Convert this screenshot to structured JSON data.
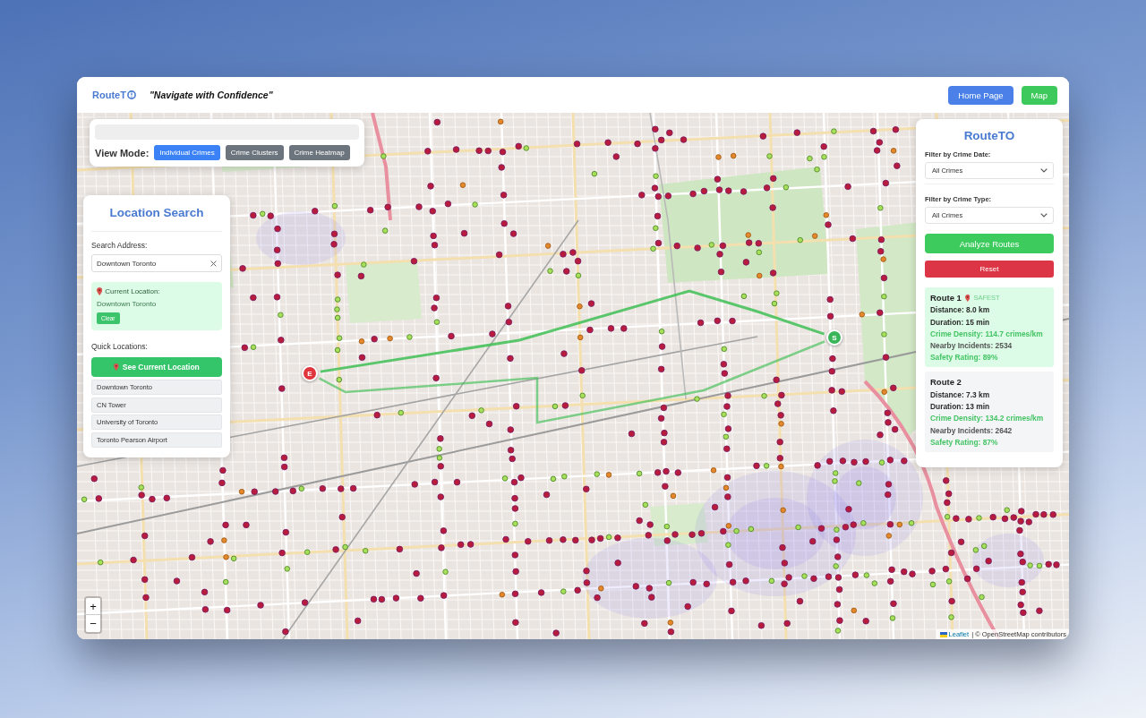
{
  "header": {
    "logo": "RouteT",
    "tagline": "\"Navigate with Confidence\"",
    "nav_buttons": [
      {
        "label": "Home Page",
        "kind": "primary"
      },
      {
        "label": "Map",
        "kind": "success"
      }
    ]
  },
  "view_mode": {
    "label": "View Mode:",
    "modes": [
      {
        "label": "Individual Crimes",
        "selected": true
      },
      {
        "label": "Crime Clusters",
        "selected": false
      },
      {
        "label": "Crime Heatmap",
        "selected": false
      }
    ]
  },
  "location_search": {
    "title": "Location Search",
    "search_label": "Search Address:",
    "search_value": "Downtown Toronto",
    "current_location": {
      "label": "Current Location:",
      "value": "Downtown Toronto",
      "clear_button": "Clear"
    },
    "quick_label": "Quick Locations:",
    "locate_button": "See Current Location",
    "quick_locations": [
      "Downtown Toronto",
      "CN Tower",
      "University of Toronto",
      "Toronto Pearson Airport"
    ]
  },
  "route_panel": {
    "title": "RouteTO",
    "filters": [
      {
        "label": "Filter by Crime Date:",
        "value": "All Crimes"
      },
      {
        "label": "Filter by Crime Type:",
        "value": "All Crimes"
      }
    ],
    "analyze_button": "Analyze Routes",
    "reset_button": "Reset",
    "routes": [
      {
        "name": "Route 1",
        "badge": "SAFEST",
        "selected": true,
        "lines": [
          {
            "text": "Distance: 8.0 km",
            "kind": "plain"
          },
          {
            "text": "Duration: 15 min",
            "kind": "plain"
          },
          {
            "text": "Crime Density: 114.7 crimes/km",
            "kind": "good"
          },
          {
            "text": "Nearby Incidents: 2534",
            "kind": "muted"
          },
          {
            "text": "Safety Rating: 89%",
            "kind": "good"
          }
        ]
      },
      {
        "name": "Route 2",
        "selected": false,
        "lines": [
          {
            "text": "Distance: 7.3 km",
            "kind": "plain"
          },
          {
            "text": "Duration: 13 min",
            "kind": "plain"
          },
          {
            "text": "Crime Density: 134.2 crimes/km",
            "kind": "good"
          },
          {
            "text": "Nearby Incidents: 2642",
            "kind": "muted"
          },
          {
            "text": "Safety Rating: 87%",
            "kind": "good"
          }
        ]
      }
    ]
  },
  "map": {
    "markers": [
      {
        "label": "S",
        "kind": "start"
      },
      {
        "label": "E",
        "kind": "end"
      }
    ],
    "zoom_controls": [
      "+",
      "−"
    ],
    "attribution": {
      "link": "Leaflet",
      "text": "| © OpenStreetMap contributors"
    }
  }
}
